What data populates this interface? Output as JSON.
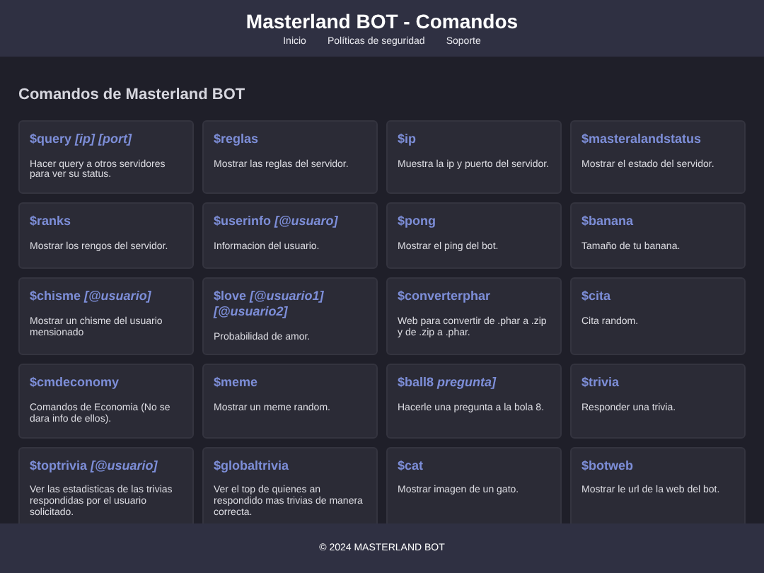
{
  "header": {
    "title": "Masterland BOT - Comandos",
    "nav": [
      "Inicio",
      "Políticas de seguridad",
      "Soporte"
    ]
  },
  "section_title": "Comandos de Masterland BOT",
  "commands": [
    {
      "name": "$query *[ip] [port]*",
      "description": "Hacer query a otros servidores para ver su status."
    },
    {
      "name": "$reglas",
      "description": "Mostrar las reglas del servidor."
    },
    {
      "name": "$ip",
      "description": "Muestra la ip y puerto del servidor."
    },
    {
      "name": "$masteralandstatus",
      "description": "Mostrar el estado del servidor."
    },
    {
      "name": "$ranks",
      "description": "Mostrar los rengos del servidor."
    },
    {
      "name": "$userinfo *[@usuaro]*",
      "description": "Informacion del usuario."
    },
    {
      "name": "$pong",
      "description": "Mostrar el ping del bot."
    },
    {
      "name": "$banana",
      "description": "Tamaño de tu banana."
    },
    {
      "name": "$chisme *[@usuario]*",
      "description": "Mostrar un chisme del usuario mensionado"
    },
    {
      "name": "$love *[@usuario1] [@usuario2]*",
      "description": "Probabilidad de amor."
    },
    {
      "name": "$converterphar",
      "description": "Web para convertir de .phar a .zip y de .zip a .phar."
    },
    {
      "name": "$cita",
      "description": "Cita random."
    },
    {
      "name": "$cmdeconomy",
      "description": "Comandos de Economia (No se dara info de ellos)."
    },
    {
      "name": "$meme",
      "description": "Mostrar un meme random."
    },
    {
      "name": "$ball8 *pregunta]*",
      "description": "Hacerle una pregunta a la bola 8."
    },
    {
      "name": "$trivia",
      "description": "Responder una trivia."
    },
    {
      "name": "$toptrivia *[@usuario]*",
      "description": "Ver las estadisticas de las trivias respondidas por el usuario solicitado."
    },
    {
      "name": "$globaltrivia",
      "description": "Ver el top de quienes an respondido mas trivias de manera correcta."
    },
    {
      "name": "$cat",
      "description": "Mostrar imagen de un gato."
    },
    {
      "name": "$botweb",
      "description": "Mostrar le url de la web del bot."
    }
  ],
  "footer": "© 2024 MASTERLAND BOT"
}
